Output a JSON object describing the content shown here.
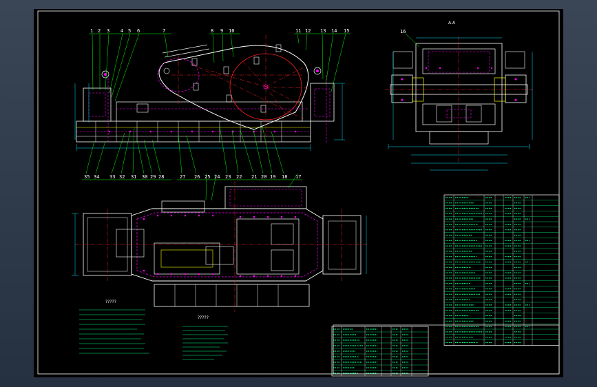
{
  "colors": {
    "frame": "#ffffff",
    "outline": "#ffffff",
    "hidden": "#ff00ff",
    "center": "#ff2020",
    "dim": "#00e5ff",
    "leader": "#00ff00",
    "yellow": "#ffff00",
    "table": "#00ff7f"
  },
  "callouts": {
    "top": [
      "1",
      "2",
      "3",
      "4",
      "5",
      "6",
      "7",
      "8",
      "9",
      "10",
      "11",
      "12",
      "13",
      "14",
      "15"
    ],
    "bottom": [
      "35",
      "34",
      "33",
      "32",
      "31",
      "30",
      "29",
      "28",
      "27",
      "26",
      "25",
      "24",
      "23",
      "22",
      "21",
      "20",
      "19",
      "18",
      "17"
    ],
    "section_marker": "16"
  },
  "section_label": "A-A",
  "notes_left_title": "?????",
  "notes_right_title": "?????",
  "bom_rows": 28,
  "bom2_rows": 9
}
